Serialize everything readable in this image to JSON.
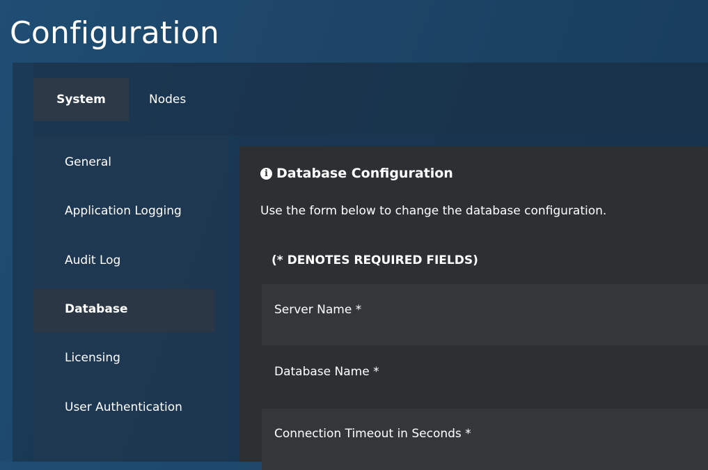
{
  "page": {
    "title": "Configuration"
  },
  "tabs": [
    {
      "label": "System"
    },
    {
      "label": "Nodes"
    }
  ],
  "sidebar": {
    "items": [
      {
        "label": "General"
      },
      {
        "label": "Application Logging"
      },
      {
        "label": "Audit Log"
      },
      {
        "label": "Database"
      },
      {
        "label": "Licensing"
      },
      {
        "label": "User Authentication"
      }
    ]
  },
  "content": {
    "title": "Database Configuration",
    "title_icon": "info-circle",
    "description": "Use the form below to change the database configuration.",
    "required_note": "(* DENOTES REQUIRED FIELDS)",
    "fields": [
      {
        "label": "Server Name *"
      },
      {
        "label": "Database Name *"
      },
      {
        "label": "Connection Timeout in Seconds *"
      }
    ]
  },
  "colors": {
    "background": "#1d4567",
    "content_panel": "#2d3033",
    "active_tab": "#2c3a48",
    "text": "#ffffff"
  }
}
